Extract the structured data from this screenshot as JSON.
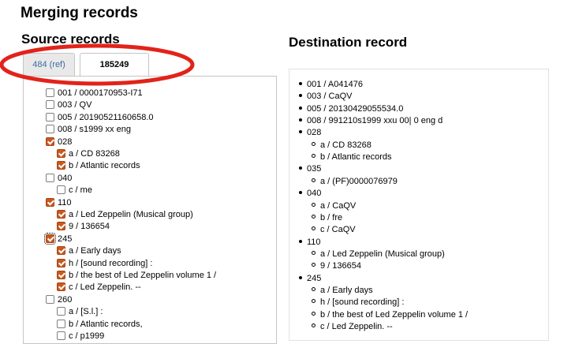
{
  "page": {
    "title": "Merging records"
  },
  "source": {
    "title": "Source records",
    "tabs": [
      {
        "label": "484 (ref)"
      },
      {
        "label": "185249"
      }
    ],
    "rows": [
      {
        "text": "001 / 0000170953-I71",
        "checked": false,
        "indent": 0
      },
      {
        "text": "003 / QV",
        "checked": false,
        "indent": 0
      },
      {
        "text": "005 / 20190521160658.0",
        "checked": false,
        "indent": 0
      },
      {
        "text": "008 / s1999 xx eng",
        "checked": false,
        "indent": 0
      },
      {
        "text": "028",
        "checked": true,
        "indent": 0
      },
      {
        "text": "a / CD 83268",
        "checked": true,
        "indent": 1
      },
      {
        "text": "b / Atlantic records",
        "checked": true,
        "indent": 1
      },
      {
        "text": "040",
        "checked": false,
        "indent": 0
      },
      {
        "text": "c / me",
        "checked": false,
        "indent": 1
      },
      {
        "text": "110",
        "checked": true,
        "indent": 0
      },
      {
        "text": "a / Led Zeppelin (Musical group)",
        "checked": true,
        "indent": 1
      },
      {
        "text": "9 / 136654",
        "checked": true,
        "indent": 1
      },
      {
        "text": "245",
        "checked": true,
        "indent": 0,
        "focused": true
      },
      {
        "text": "a / Early days",
        "checked": true,
        "indent": 1
      },
      {
        "text": "h / [sound recording] :",
        "checked": true,
        "indent": 1
      },
      {
        "text": "b / the best of Led Zeppelin volume 1 /",
        "checked": true,
        "indent": 1
      },
      {
        "text": "c / Led Zeppelin. --",
        "checked": true,
        "indent": 1
      },
      {
        "text": "260",
        "checked": false,
        "indent": 0
      },
      {
        "text": "a / [S.l.] :",
        "checked": false,
        "indent": 1
      },
      {
        "text": "b / Atlantic records,",
        "checked": false,
        "indent": 1
      },
      {
        "text": "c / p1999",
        "checked": false,
        "indent": 1
      }
    ]
  },
  "destination": {
    "title": "Destination record",
    "rows": [
      {
        "text": "001 / A041476",
        "level": 0
      },
      {
        "text": "003 / CaQV",
        "level": 0
      },
      {
        "text": "005 / 20130429055534.0",
        "level": 0
      },
      {
        "text": "008 / 991210s1999 xxu 00| 0 eng d",
        "level": 0
      },
      {
        "text": "028",
        "level": 0
      },
      {
        "text": "a / CD 83268",
        "level": 1
      },
      {
        "text": "b / Atlantic records",
        "level": 1
      },
      {
        "text": "035",
        "level": 0
      },
      {
        "text": "a / (PF)0000076979",
        "level": 1
      },
      {
        "text": "040",
        "level": 0
      },
      {
        "text": "a / CaQV",
        "level": 1
      },
      {
        "text": "b / fre",
        "level": 1
      },
      {
        "text": "c / CaQV",
        "level": 1
      },
      {
        "text": "110",
        "level": 0
      },
      {
        "text": "a / Led Zeppelin (Musical group)",
        "level": 1
      },
      {
        "text": "9 / 136654",
        "level": 1
      },
      {
        "text": "245",
        "level": 0
      },
      {
        "text": "a / Early days",
        "level": 1
      },
      {
        "text": "h / [sound recording] :",
        "level": 1
      },
      {
        "text": "b / the best of Led Zeppelin volume 1 /",
        "level": 1
      },
      {
        "text": "c / Led Zeppelin. --",
        "level": 1
      }
    ]
  },
  "colors": {
    "checkbox_checked": "#c9581e",
    "annotation_ellipse": "#e2231a",
    "tab_link": "#3b6ea5"
  }
}
